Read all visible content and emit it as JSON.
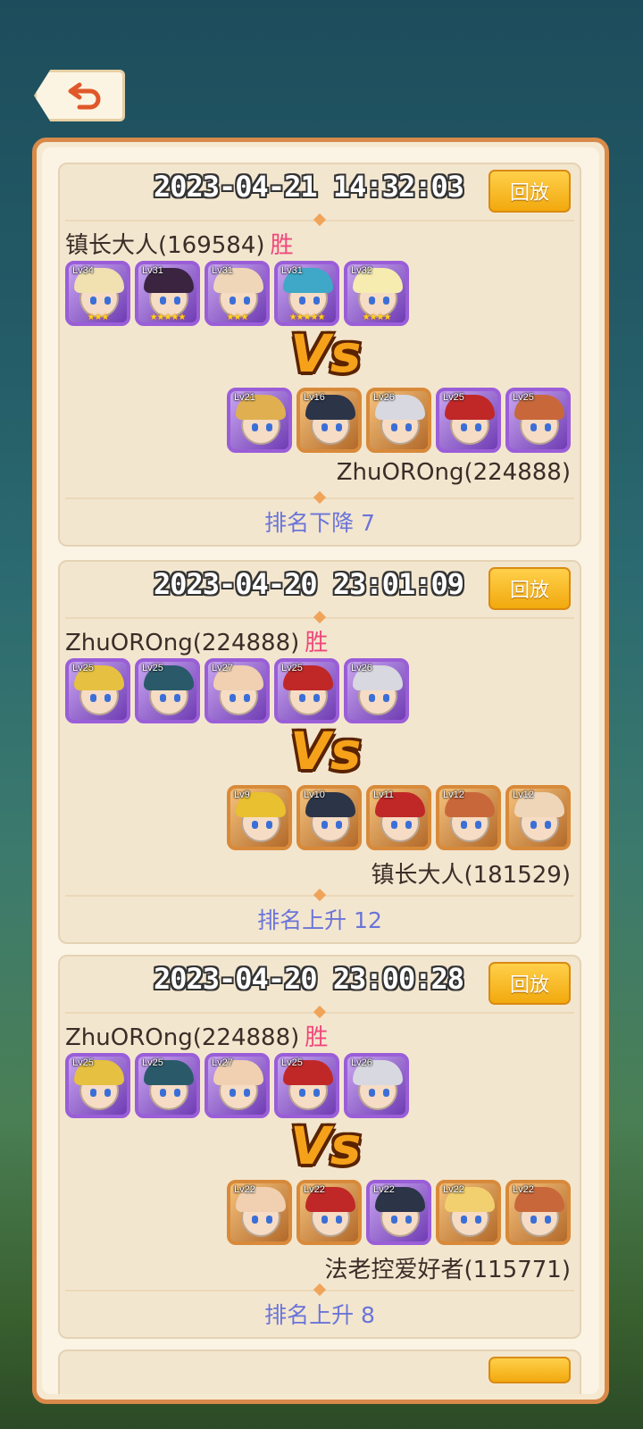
{
  "back_button": {
    "icon": "back-arrow-icon"
  },
  "battles": [
    {
      "time": "2023-04-21 14:32:03",
      "replay_label": "回放",
      "player1": {
        "name": "镇长大人(169584)",
        "result": "胜"
      },
      "team1": [
        {
          "lv": "Lv34",
          "frame": "purple",
          "hair": "#f1e0b0",
          "stars": "★★★"
        },
        {
          "lv": "Lv31",
          "frame": "purple",
          "hair": "#3a2440",
          "stars": "★★★★★"
        },
        {
          "lv": "Lv31",
          "frame": "purple",
          "hair": "#f0d6b8",
          "stars": "★★★"
        },
        {
          "lv": "Lv31",
          "frame": "purple",
          "hair": "#3fa7c8",
          "stars": "★★★★★"
        },
        {
          "lv": "Lv32",
          "frame": "purple",
          "hair": "#f6ecb0",
          "stars": "★★★★"
        }
      ],
      "vs": "Vs",
      "team2": [
        {
          "lv": "Lv21",
          "frame": "purple",
          "hair": "#e0b050",
          "stars": ""
        },
        {
          "lv": "Lv16",
          "frame": "orange",
          "hair": "#2c3448",
          "stars": ""
        },
        {
          "lv": "Lv26",
          "frame": "orange",
          "hair": "#d8d8e0",
          "stars": ""
        },
        {
          "lv": "Lv25",
          "frame": "purple",
          "hair": "#c02828",
          "stars": ""
        },
        {
          "lv": "Lv25",
          "frame": "purple",
          "hair": "#c8683a",
          "stars": ""
        }
      ],
      "player2": "ZhuOROng(224888)",
      "rank_change": "排名下降 7"
    },
    {
      "time": "2023-04-20 23:01:09",
      "replay_label": "回放",
      "player1": {
        "name": "ZhuOROng(224888)",
        "result": "胜"
      },
      "team1": [
        {
          "lv": "Lv25",
          "frame": "purple",
          "hair": "#e6c040",
          "stars": ""
        },
        {
          "lv": "Lv25",
          "frame": "purple",
          "hair": "#2a5a6a",
          "stars": ""
        },
        {
          "lv": "Lv27",
          "frame": "purple",
          "hair": "#f0d0b0",
          "stars": ""
        },
        {
          "lv": "Lv25",
          "frame": "purple",
          "hair": "#c02828",
          "stars": ""
        },
        {
          "lv": "Lv26",
          "frame": "purple",
          "hair": "#d8d8e0",
          "stars": ""
        }
      ],
      "vs": "Vs",
      "team2": [
        {
          "lv": "Lv9",
          "frame": "orange",
          "hair": "#e8c030",
          "stars": ""
        },
        {
          "lv": "Lv10",
          "frame": "orange",
          "hair": "#2c3448",
          "stars": ""
        },
        {
          "lv": "Lv11",
          "frame": "orange",
          "hair": "#c02828",
          "stars": ""
        },
        {
          "lv": "Lv12",
          "frame": "orange",
          "hair": "#c8683a",
          "stars": ""
        },
        {
          "lv": "Lv12",
          "frame": "orange",
          "hair": "#f0d6b8",
          "stars": ""
        }
      ],
      "player2": "镇长大人(181529)",
      "rank_change": "排名上升 12"
    },
    {
      "time": "2023-04-20 23:00:28",
      "replay_label": "回放",
      "player1": {
        "name": "ZhuOROng(224888)",
        "result": "胜"
      },
      "team1": [
        {
          "lv": "Lv25",
          "frame": "purple",
          "hair": "#e6c040",
          "stars": ""
        },
        {
          "lv": "Lv25",
          "frame": "purple",
          "hair": "#2a5a6a",
          "stars": ""
        },
        {
          "lv": "Lv27",
          "frame": "purple",
          "hair": "#f0d0b0",
          "stars": ""
        },
        {
          "lv": "Lv25",
          "frame": "purple",
          "hair": "#c02828",
          "stars": ""
        },
        {
          "lv": "Lv26",
          "frame": "purple",
          "hair": "#d8d8e0",
          "stars": ""
        }
      ],
      "vs": "Vs",
      "team2": [
        {
          "lv": "Lv22",
          "frame": "orange",
          "hair": "#f0d0b0",
          "stars": ""
        },
        {
          "lv": "Lv22",
          "frame": "orange",
          "hair": "#c02828",
          "stars": ""
        },
        {
          "lv": "Lv22",
          "frame": "purple",
          "hair": "#2c3448",
          "stars": ""
        },
        {
          "lv": "Lv22",
          "frame": "orange",
          "hair": "#f2d070",
          "stars": ""
        },
        {
          "lv": "Lv22",
          "frame": "orange",
          "hair": "#c8683a",
          "stars": ""
        }
      ],
      "player2": "法老控爱好者(115771)",
      "rank_change": "排名上升 8"
    }
  ]
}
